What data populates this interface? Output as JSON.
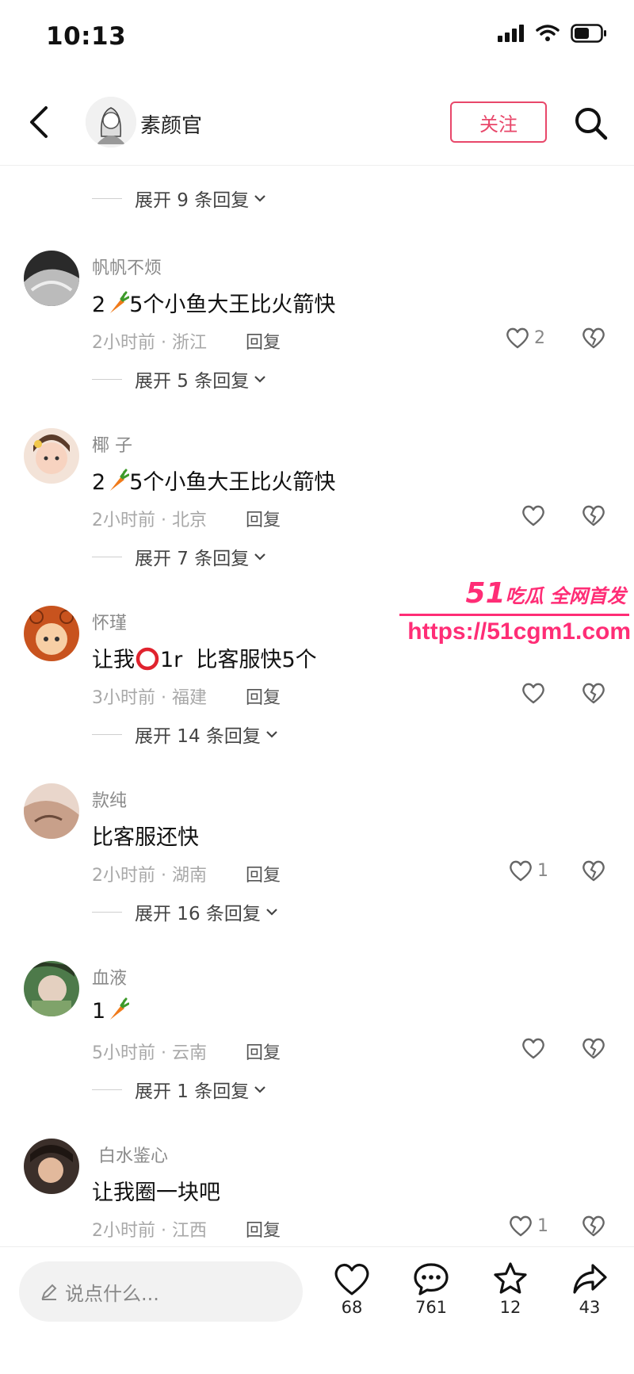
{
  "status_bar": {
    "time": "10:13"
  },
  "nav": {
    "title": "素颜官",
    "follow_label": "关注"
  },
  "top_expand": "展开 9 条回复",
  "comments": [
    {
      "name": "帆帆不烦",
      "text_a": "2",
      "text_b": "5个小鱼大王比火箭快",
      "time": "2小时前 · 浙江",
      "reply": "回复",
      "likes": "2",
      "expand": "展开 5 条回复"
    },
    {
      "name": "椰 子",
      "text_a": "2",
      "text_b": "5个小鱼大王比火箭快",
      "time": "2小时前 · 北京",
      "reply": "回复",
      "likes": "",
      "expand": "展开 7 条回复"
    },
    {
      "name": "怀瑾",
      "text_a": "让我",
      "text_b": "1r  比客服快5个",
      "time": "3小时前 · 福建",
      "reply": "回复",
      "likes": "",
      "expand": "展开 14 条回复"
    },
    {
      "name": "款纯",
      "text_a": "比客服还快",
      "text_b": "",
      "time": "2小时前 · 湖南",
      "reply": "回复",
      "likes": "1",
      "expand": "展开 16 条回复"
    },
    {
      "name": "血液",
      "text_a": "1",
      "text_b": "",
      "time": "5小时前 · 云南",
      "reply": "回复",
      "likes": "",
      "expand": "展开 1 条回复"
    },
    {
      "name": "白水鉴心",
      "text_a": "让我圈一块吧",
      "text_b": "",
      "time": "2小时前 · 江西",
      "reply": "回复",
      "likes": "1",
      "expand": ""
    }
  ],
  "watermark": {
    "brand": "51",
    "brand_tail": "吃瓜 全网首发",
    "url": "https://51cgm1.com"
  },
  "bottom_bar": {
    "placeholder": "说点什么...",
    "like_count": "68",
    "comment_count": "761",
    "star_count": "12",
    "share_count": "43"
  },
  "colors": {
    "accent": "#e8476a",
    "watermark": "#ff2d76"
  },
  "icons": [
    "back-arrow-icon",
    "search-icon",
    "signal-icon",
    "wifi-icon",
    "battery-icon",
    "heart-icon",
    "broken-heart-icon",
    "chevron-down-icon",
    "carrot-icon",
    "red-circle-icon",
    "pencil-icon",
    "comment-bubble-icon",
    "star-icon",
    "share-arrow-icon"
  ]
}
